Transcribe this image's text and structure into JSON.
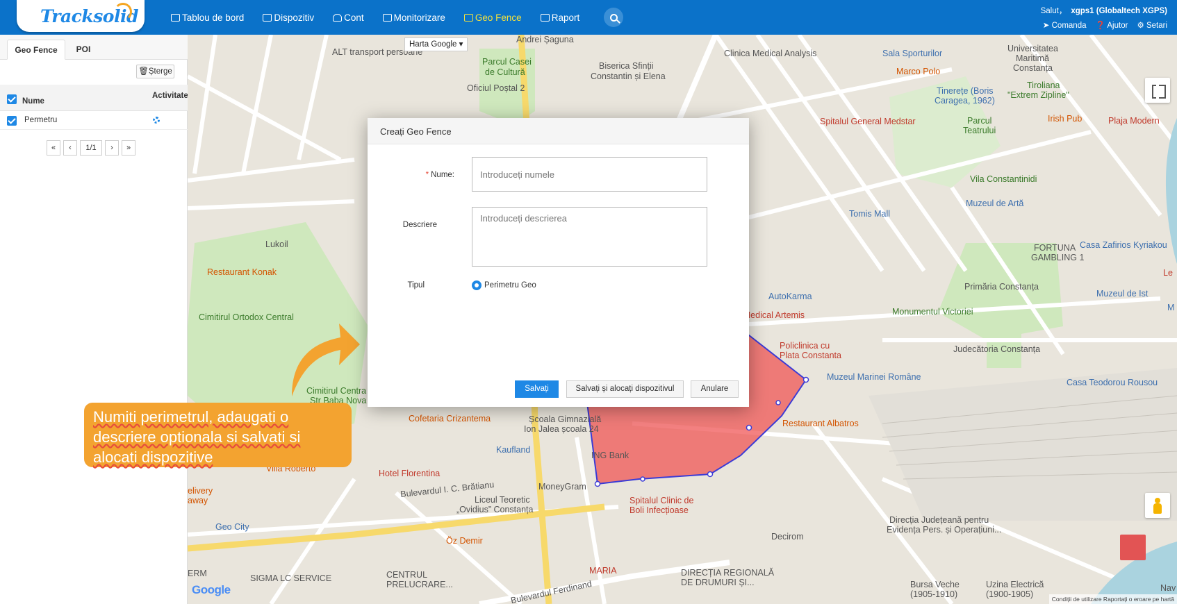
{
  "header": {
    "logo": "Tracksolid",
    "nav": [
      {
        "label": "Tablou de bord",
        "icon": "dashboard-icon"
      },
      {
        "label": "Dispozitiv",
        "icon": "car-icon"
      },
      {
        "label": "Cont",
        "icon": "users-icon"
      },
      {
        "label": "Monitorizare",
        "icon": "map-icon"
      },
      {
        "label": "Geo Fence",
        "icon": "geofence-icon",
        "active": true
      },
      {
        "label": "Raport",
        "icon": "table-icon"
      }
    ],
    "greeting": "Salut，",
    "username": "xgps1 (Globaltech XGPS)",
    "links": {
      "command": "Comanda",
      "help": "Ajutor",
      "settings": "Setari"
    }
  },
  "sidebar": {
    "tabs": [
      "Geo Fence",
      "POI"
    ],
    "delete_label": "Șterge",
    "columns": {
      "name": "Nume",
      "active": "Activitate"
    },
    "rows": [
      {
        "name": "Permetru"
      }
    ],
    "pager": {
      "first": "«",
      "prev": "‹",
      "page": "1/1",
      "next": "›",
      "last": "»"
    }
  },
  "map": {
    "type_label": "Harta Google",
    "google": "Google",
    "footer": "Condiții de utilizare    Raportați o eroare pe hartă",
    "labels": [
      {
        "t": "Andrei Șaguna",
        "c": ""
      },
      {
        "t": "ALT transport persoane",
        "c": ""
      },
      {
        "t": "Parcul Casei",
        "c": "green"
      },
      {
        "t": "de Cultură",
        "c": "green"
      },
      {
        "t": "Biserica Sfinții",
        "c": ""
      },
      {
        "t": "Constantin și Elena",
        "c": ""
      },
      {
        "t": "Clinica Medical Analysis",
        "c": ""
      },
      {
        "t": "Sala Sporturilor",
        "c": "blue"
      },
      {
        "t": "Universitatea",
        "c": ""
      },
      {
        "t": "Maritimă",
        "c": ""
      },
      {
        "t": "Constanța",
        "c": ""
      },
      {
        "t": "Marco Polo",
        "c": "orange"
      },
      {
        "t": "Oficiul Poștal 2",
        "c": ""
      },
      {
        "t": "Tinerețe (Boris",
        "c": "blue"
      },
      {
        "t": "Caragea, 1962)",
        "c": "blue"
      },
      {
        "t": "Tiroliana",
        "c": "green"
      },
      {
        "t": "\"Extrem Zipline\"",
        "c": "green"
      },
      {
        "t": "Spitalul General Medstar",
        "c": "red"
      },
      {
        "t": "Irish Pub",
        "c": "orange"
      },
      {
        "t": "Plaja Modern",
        "c": "red"
      },
      {
        "t": "Parcul",
        "c": "green"
      },
      {
        "t": "Teatrului",
        "c": "green"
      },
      {
        "t": "Vila Constantinidi",
        "c": "green"
      },
      {
        "t": "Muzeul de Artă",
        "c": "blue"
      },
      {
        "t": "Tomis Mall",
        "c": "blue"
      },
      {
        "t": "Lukoil",
        "c": ""
      },
      {
        "t": "FORTUNA",
        "c": ""
      },
      {
        "t": "GAMBLING 1",
        "c": ""
      },
      {
        "t": "Casa Zafirios Kyriakou",
        "c": "blue"
      },
      {
        "t": "Restaurant Konak",
        "c": "orange"
      },
      {
        "t": "Primăria Constanța",
        "c": ""
      },
      {
        "t": "AutoKarma",
        "c": "blue"
      },
      {
        "t": "Muzeul de Ist",
        "c": "blue"
      },
      {
        "t": "Monumentul Victoriei",
        "c": "green"
      },
      {
        "t": "Cimitirul Ortodox Central",
        "c": "green"
      },
      {
        "t": "Centrul Medical Artemis",
        "c": "red"
      },
      {
        "t": "Policlinica cu",
        "c": "red"
      },
      {
        "t": "Plata Constanta",
        "c": "red"
      },
      {
        "t": "Judecătoria Constanța",
        "c": ""
      },
      {
        "t": "Muzeul Marinei Române",
        "c": "blue"
      },
      {
        "t": "Casa Teodorou Rousou",
        "c": "blue"
      },
      {
        "t": "Cimitirul Centra",
        "c": "green"
      },
      {
        "t": "Str Baba Nova",
        "c": "green"
      },
      {
        "t": "Cofetaria Crizantema",
        "c": "orange"
      },
      {
        "t": "Școala Gimnazială",
        "c": ""
      },
      {
        "t": "Ion Jalea școala 24",
        "c": ""
      },
      {
        "t": "Restaurant Albatros",
        "c": "orange"
      },
      {
        "t": "Kaufland",
        "c": "blue"
      },
      {
        "t": "ING Bank",
        "c": ""
      },
      {
        "t": "Villa Roberto",
        "c": "orange"
      },
      {
        "t": "Hotel Florentina",
        "c": "red"
      },
      {
        "t": "Bulevardul I. C. Brătianu",
        "c": ""
      },
      {
        "t": "MoneyGram",
        "c": ""
      },
      {
        "t": "Liceul Teoretic",
        "c": ""
      },
      {
        "t": "„Ovidius” Constanța",
        "c": ""
      },
      {
        "t": "Spitalul Clinic de",
        "c": "red"
      },
      {
        "t": "Boli Infecțioase",
        "c": "red"
      },
      {
        "t": "Geo City",
        "c": "blue"
      },
      {
        "t": "Öz Demir",
        "c": "orange"
      },
      {
        "t": "Direcția Județeană pentru",
        "c": ""
      },
      {
        "t": "Evidența Pers. și Operațiuni...",
        "c": ""
      },
      {
        "t": "Decirom",
        "c": ""
      },
      {
        "t": "SIGMA LC SERVICE",
        "c": ""
      },
      {
        "t": "CENTRUL",
        "c": ""
      },
      {
        "t": "PRELUCRARE...",
        "c": ""
      },
      {
        "t": "MARIA",
        "c": "red"
      },
      {
        "t": "DIRECȚIA REGIONALĂ",
        "c": ""
      },
      {
        "t": "DE DRUMURI ȘI...",
        "c": ""
      },
      {
        "t": "Bursa Veche",
        "c": ""
      },
      {
        "t": "(1905-1910)",
        "c": ""
      },
      {
        "t": "Uzina Electrică",
        "c": ""
      },
      {
        "t": "(1900-1905)",
        "c": ""
      },
      {
        "t": "Bulevardul Ferdinand",
        "c": ""
      },
      {
        "t": "ERM",
        "c": ""
      },
      {
        "t": "elivery",
        "c": "orange"
      },
      {
        "t": "away",
        "c": "orange"
      },
      {
        "t": "Nav",
        "c": ""
      },
      {
        "t": "Le",
        "c": "red"
      },
      {
        "t": "M",
        "c": "blue"
      }
    ]
  },
  "callout": {
    "text": "Numiti perimetrul, adaugati o descriere optionala si salvati si alocati dispozitive"
  },
  "dialog": {
    "title": "Creați Geo Fence",
    "name_label": "Nume:",
    "name_required": "*",
    "name_placeholder": "Introduceți numele",
    "desc_label": "Descriere",
    "desc_placeholder": "Introduceți descrierea",
    "type_label": "Tipul",
    "type_option": "Perimetru Geo",
    "buttons": {
      "save": "Salvați",
      "save_assign": "Salvați și alocați dispozitivul",
      "cancel": "Anulare"
    }
  },
  "colors": {
    "header": "#0b72c9",
    "active_nav": "#f5e23b",
    "fence": "#f05a5a",
    "fence_border": "#3b3bd6",
    "callout": "#f3a330",
    "primary": "#1e88e5"
  }
}
